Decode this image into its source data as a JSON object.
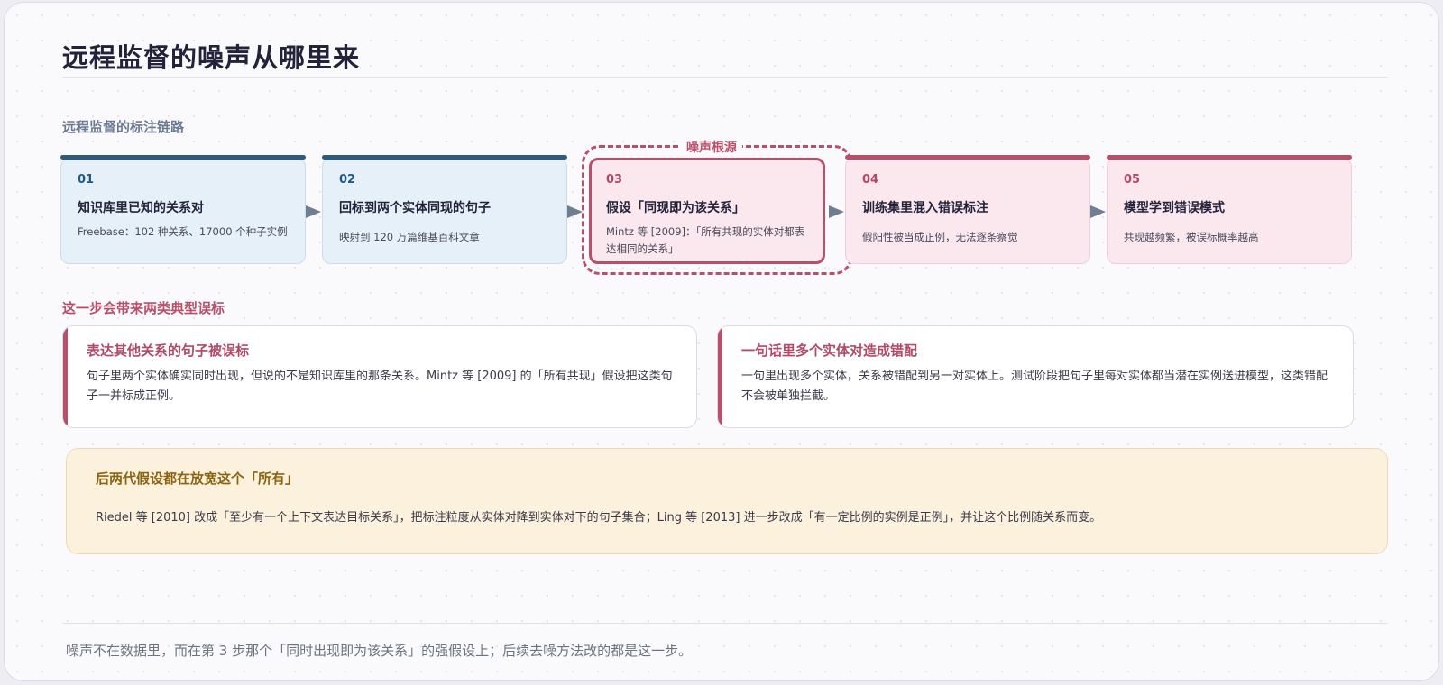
{
  "title": "远程监督的噪声从哪里来",
  "chain_label": "远程监督的标注链路",
  "focus_label": "噪声根源",
  "steps": [
    {
      "num": "01",
      "title": "知识库里已知的关系对",
      "desc": "Freebase：102 种关系、17000 个种子实例"
    },
    {
      "num": "02",
      "title": "回标到两个实体同现的句子",
      "desc": "映射到 120 万篇维基百科文章"
    },
    {
      "num": "03",
      "title": "假设「同现即为该关系」",
      "desc": "Mintz 等 [2009]：「所有共现的实体对都表达相同的关系」"
    },
    {
      "num": "04",
      "title": "训练集里混入错误标注",
      "desc": "假阳性被当成正例，无法逐条察觉"
    },
    {
      "num": "05",
      "title": "模型学到错误模式",
      "desc": "共现越频繁，被误标概率越高"
    }
  ],
  "mislabel_label": "这一步会带来两类典型误标",
  "mislabels": [
    {
      "title": "表达其他关系的句子被误标",
      "body": "句子里两个实体确实同时出现，但说的不是知识库里的那条关系。Mintz 等 [2009] 的「所有共现」假设把这类句子一并标成正例。"
    },
    {
      "title": "一句话里多个实体对造成错配",
      "body": "一句里出现多个实体，关系被错配到另一对实体上。测试阶段把句子里每对实体都当潜在实例送进模型，这类错配不会被单独拦截。"
    }
  ],
  "note": {
    "title": "后两代假设都在放宽这个「所有」",
    "body": "Riedel 等 [2010] 改成「至少有一个上下文表达目标关系」，把标注粒度从实体对降到实体对下的句子集合；Ling 等 [2013] 进一步改成「有一定比例的实例是正例」，并让这个比例随关系而变。"
  },
  "footer": "噪声不在数据里，而在第 3 步那个「同时出现即为该关系」的强假设上；后续去噪方法改的都是这一步。",
  "colors": {
    "blue_accent": "#2d5b80",
    "pink_accent": "#b8506a",
    "note_bg": "#fbf1dc",
    "note_title": "#8a6412"
  }
}
